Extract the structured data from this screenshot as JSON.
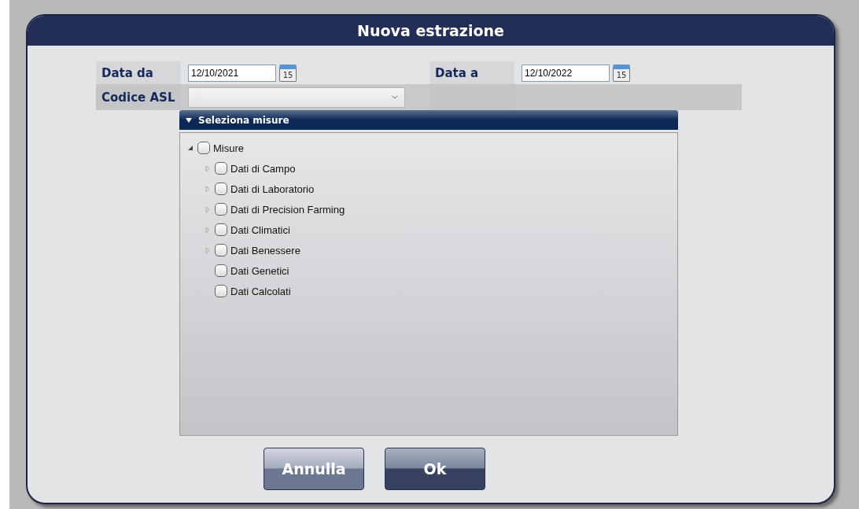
{
  "dialog": {
    "title": "Nuova estrazione"
  },
  "form": {
    "date_from": {
      "label": "Data da",
      "value": "12/10/2021",
      "calendar_day": "15"
    },
    "date_to": {
      "label": "Data a",
      "value": "12/10/2022",
      "calendar_day": "15"
    },
    "asl_code": {
      "label": "Codice ASL"
    }
  },
  "measures_panel": {
    "title": "Seleziona misure",
    "expanded": true,
    "tree": [
      {
        "label": "Misure",
        "checked": false,
        "expandable": true,
        "expanded": true,
        "children": [
          {
            "label": "Dati di Campo",
            "checked": false,
            "expandable": true,
            "expanded": false
          },
          {
            "label": "Dati di Laboratorio",
            "checked": false,
            "expandable": true,
            "expanded": false
          },
          {
            "label": "Dati di Precision Farming",
            "checked": false,
            "expandable": true,
            "expanded": false
          },
          {
            "label": "Dati Climatici",
            "checked": false,
            "expandable": true,
            "expanded": false
          },
          {
            "label": "Dati Benessere",
            "checked": false,
            "expandable": true,
            "expanded": false
          },
          {
            "label": "Dati Genetici",
            "checked": false,
            "expandable": false
          },
          {
            "label": "Dati Calcolati",
            "checked": false,
            "expandable": false
          }
        ]
      }
    ]
  },
  "buttons": [
    {
      "label": "Annulla",
      "kind": "secondary"
    },
    {
      "label": "Ok",
      "kind": "primary"
    }
  ]
}
